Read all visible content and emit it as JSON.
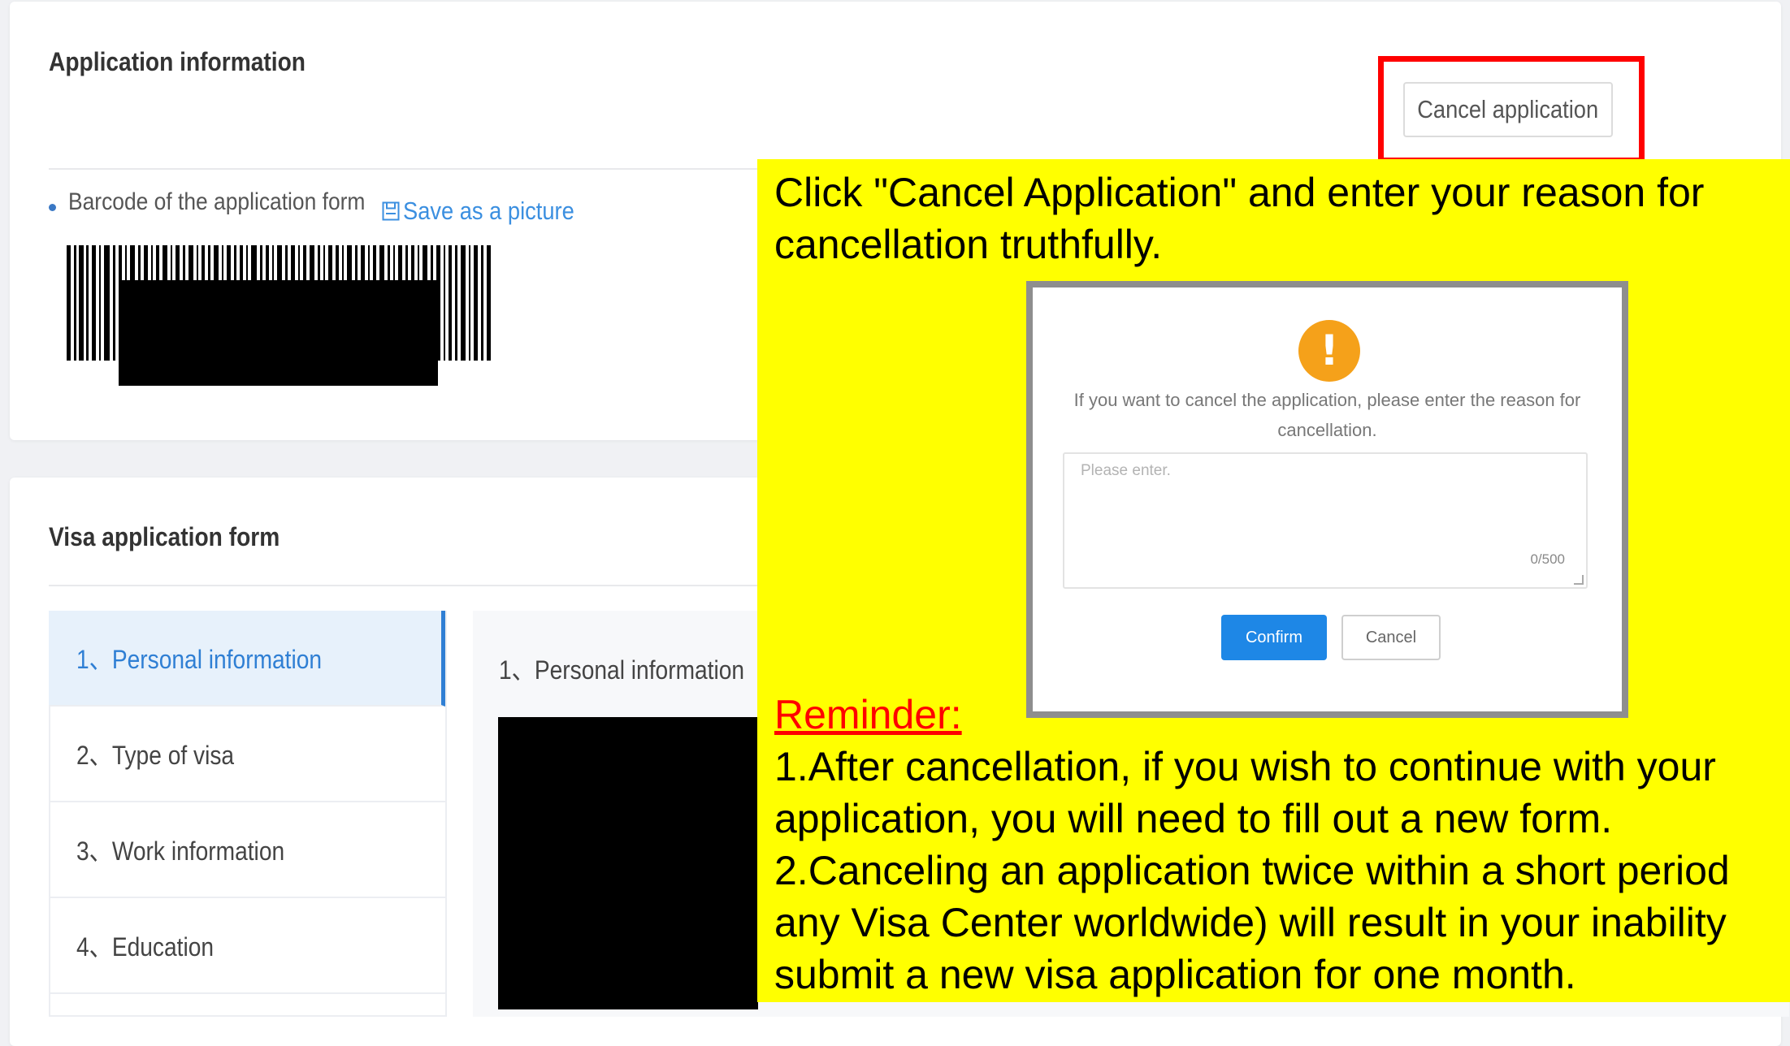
{
  "application_card": {
    "title": "Application information",
    "cancel_button_label": "Cancel application",
    "barcode_label": "Barcode of the application form",
    "save_link_label": "Save as a picture"
  },
  "visa_card": {
    "title": "Visa application form",
    "nav_items": [
      {
        "label": "1、Personal information",
        "active": true
      },
      {
        "label": "2、Type of visa",
        "active": false
      },
      {
        "label": "3、Work information",
        "active": false
      },
      {
        "label": "4、Education",
        "active": false
      }
    ],
    "content_title": "1、Personal information"
  },
  "instruction": {
    "text": "Click \"Cancel Application\" and enter your reason for cancellation truthfully.",
    "highlight_color": "#ffff00"
  },
  "modal": {
    "message": "If you want to cancel the application, please enter the reason for cancellation.",
    "textarea_placeholder": "Please enter.",
    "char_count": "0/500",
    "confirm_label": "Confirm",
    "cancel_label": "Cancel",
    "icon": "warning-icon"
  },
  "reminder": {
    "title": "Reminder:",
    "lines": [
      "1.After cancellation, if you wish to continue with your",
      "application, you will need to fill out a new form.",
      "2.Canceling an application twice within a short period",
      "any Visa Center worldwide) will result in your inability",
      "submit a new visa application for one month."
    ]
  },
  "colors": {
    "accent": "#2f7fd4",
    "link": "#3b8fe0",
    "highlight_box": "#ff0000",
    "warning": "#f5a11a",
    "confirm_button": "#1e87e6"
  }
}
